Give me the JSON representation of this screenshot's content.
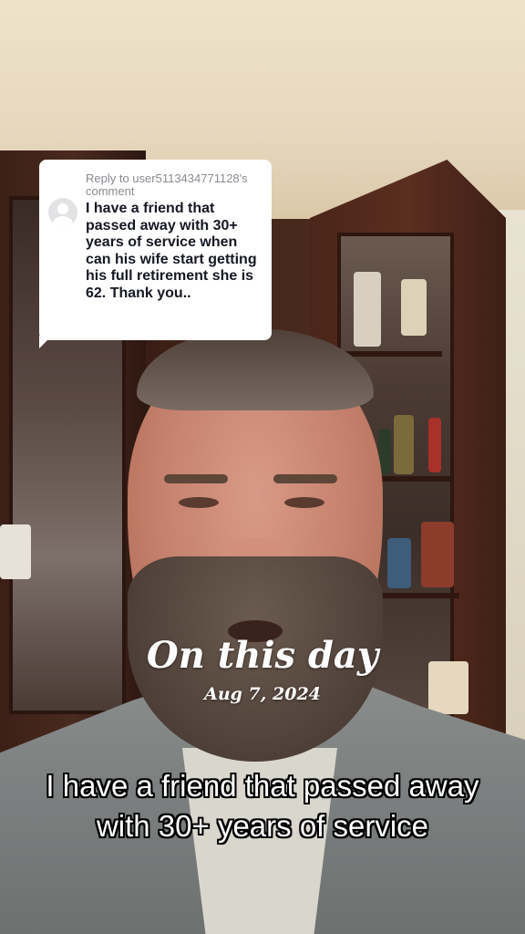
{
  "reply": {
    "header": "Reply to user5113434771128's comment",
    "comment": "I have a friend that passed away with 30+ years of service when can his wife start getting his full retirement she is 62. Thank you.."
  },
  "memory": {
    "title": "On this day",
    "date": "Aug 7, 2024"
  },
  "caption": {
    "text": "I have a friend that passed away with 30+ years of service"
  },
  "icons": {
    "avatar": "user-avatar-icon"
  },
  "colors": {
    "bubble_bg": "#ffffff",
    "bubble_text": "#161823",
    "bubble_header": "#8a8b91",
    "overlay_text": "#ffffff"
  }
}
